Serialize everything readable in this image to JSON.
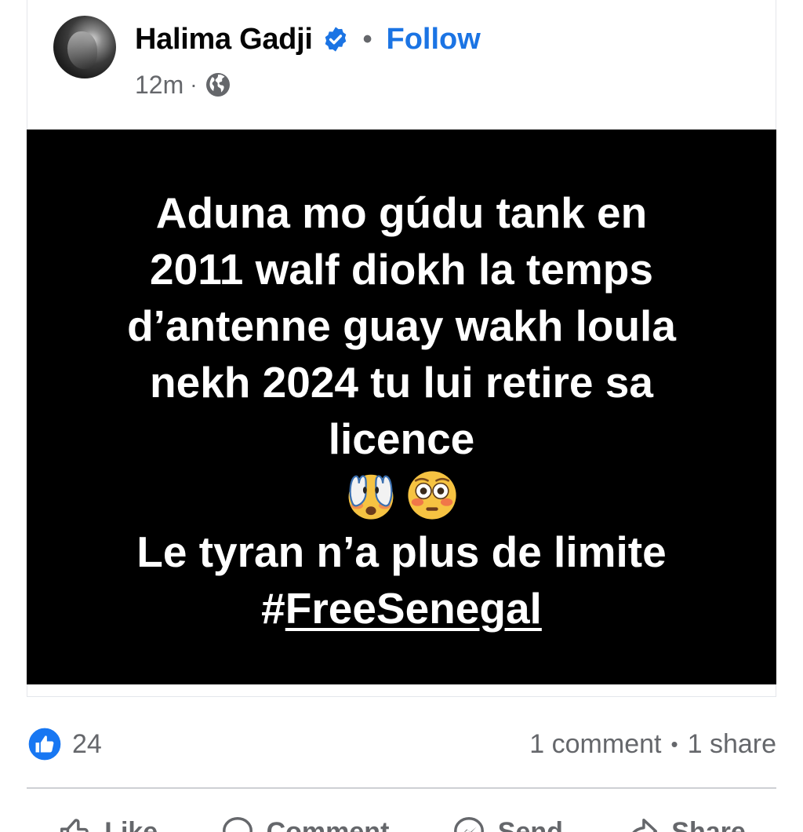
{
  "post": {
    "author_name": "Halima Gadji",
    "separator": "•",
    "follow_label": "Follow",
    "time": "12m",
    "meta_separator": "·",
    "audience_icon": "globe-icon",
    "verified_icon": "verified-badge-icon",
    "image_text": {
      "line1": "Aduna mo gúdu tank en",
      "line2": "2011 walf diokh la temps",
      "line3": "d’antenne guay wakh loula",
      "line4": "nekh 2024 tu lui retire sa",
      "line5": "licence",
      "emojis": [
        "face-with-hands-over-eyes-emoji",
        "flushed-face-emoji"
      ],
      "line6": "Le tyran n’a plus de limite",
      "hashtag_prefix": "#",
      "hashtag": "FreeSenegal"
    }
  },
  "stats": {
    "like_icon": "like-reaction-icon",
    "reaction_count": "24",
    "comments": "1 comment",
    "separator": "•",
    "shares": "1 share"
  },
  "actions": {
    "like_label": "Like",
    "comment_label": "Comment",
    "send_label": "Send",
    "share_label": "Share"
  },
  "colors": {
    "link_blue": "#1b74e4",
    "text_primary": "#050505",
    "text_secondary": "#65676b",
    "image_background": "#000000"
  }
}
